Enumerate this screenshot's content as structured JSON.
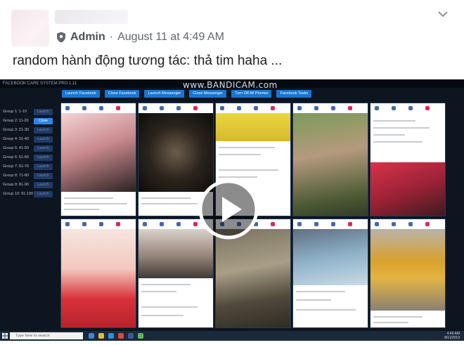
{
  "post": {
    "author": "Admin",
    "separator": "·",
    "timestamp": "August 11 at 4:49 AM",
    "text": "random hành động tương tác: thả tim haha ..."
  },
  "video": {
    "window_title": "FACEBOOK CARE SYSTEM PRO 1.11",
    "watermark": "www.BANDICAM.com",
    "toolbar": [
      "Launch Facebook",
      "Close Facebook",
      "Launch Messenger",
      "Close Messenger",
      "Turn Off All Phones",
      "Facebook Tasks"
    ],
    "groups": [
      {
        "label": "Group 1: 1-10",
        "button": "Launch",
        "active": false
      },
      {
        "label": "Group 2: 11-20",
        "button": "Close",
        "active": true
      },
      {
        "label": "Group 3: 21-30",
        "button": "Launch",
        "active": false
      },
      {
        "label": "Group 4: 31-40",
        "button": "Launch",
        "active": false
      },
      {
        "label": "Group 5: 41-50",
        "button": "Launch",
        "active": false
      },
      {
        "label": "Group 6: 51-60",
        "button": "Launch",
        "active": false
      },
      {
        "label": "Group 7: 61-70",
        "button": "Launch",
        "active": false
      },
      {
        "label": "Group 8: 71-80",
        "button": "Launch",
        "active": false
      },
      {
        "label": "Group 9: 81-90",
        "button": "Launch",
        "active": false
      },
      {
        "label": "Group 10: 91-100",
        "button": "Launch",
        "active": false
      }
    ],
    "taskbar_search": "Type here to search",
    "clock_time": "4:49 AM",
    "clock_date": "8/11/2019"
  },
  "colors": {
    "accent": "#1876d2",
    "text": "#1c1e21",
    "muted": "#616770",
    "video_bg": "#0c1520"
  }
}
